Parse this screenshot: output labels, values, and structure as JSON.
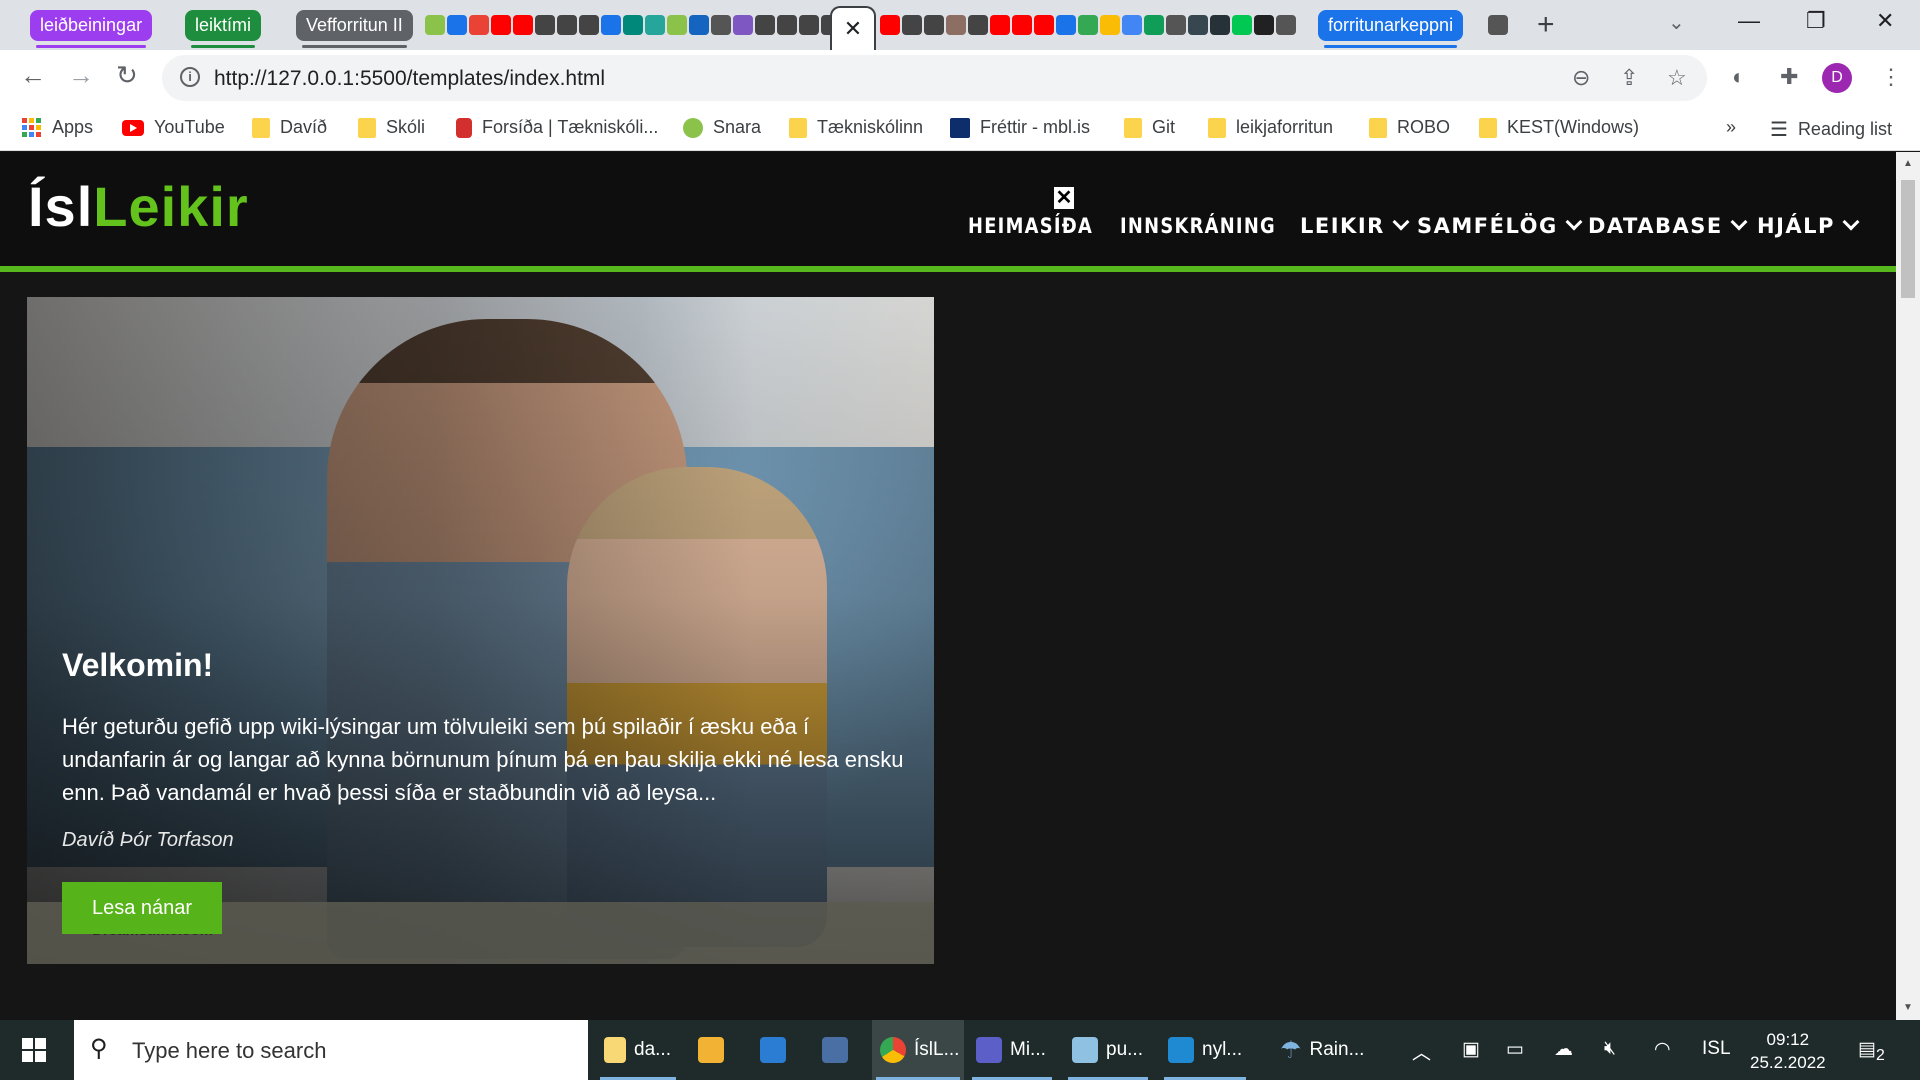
{
  "browser": {
    "tab_groups": [
      {
        "label": "leiðbeiningar",
        "color": "#9c3df0"
      },
      {
        "label": "leiktími",
        "color": "#1e8e3e"
      },
      {
        "label": "Vefforritun II",
        "color": "#5f6368"
      },
      {
        "label": "forritunarkeppni",
        "color": "#1a73e8"
      }
    ],
    "active_tab_close": "✕",
    "new_tab": "+",
    "url": "http://127.0.0.1:5500/templates/index.html",
    "profile_initial": "D"
  },
  "bookmarks": [
    {
      "label": "Apps",
      "icon": "apps-grid-icon"
    },
    {
      "label": "YouTube",
      "icon": "youtube-icon"
    },
    {
      "label": "Davíð",
      "icon": "folder-icon"
    },
    {
      "label": "Skóli",
      "icon": "folder-icon"
    },
    {
      "label": "Forsíða | Tækniskóli...",
      "icon": "tskoli-icon"
    },
    {
      "label": "Snara",
      "icon": "snara-icon"
    },
    {
      "label": "Tækniskólinn",
      "icon": "folder-icon"
    },
    {
      "label": "Fréttir - mbl.is",
      "icon": "mbl-icon"
    },
    {
      "label": "Git",
      "icon": "folder-icon"
    },
    {
      "label": "leikjaforritun",
      "icon": "folder-icon"
    },
    {
      "label": "ROBO",
      "icon": "folder-icon"
    },
    {
      "label": "KEST(Windows)",
      "icon": "folder-icon"
    }
  ],
  "bookmarks_more": "»",
  "reading_list": "Reading list",
  "site": {
    "logo_part1": "Ísl",
    "logo_part2": "Leikir",
    "nav": {
      "home": "HEIMASÍÐA",
      "login": "INNSKRÁNING",
      "games": "LEIKIR",
      "communities": "SAMFÉLÖG",
      "database": "DATABASE",
      "help": "HJÁLP"
    },
    "close_mark": "✕",
    "hero": {
      "title": "Velkomin!",
      "description": "Hér geturðu gefið upp wiki-lýsingar um tölvuleiki sem þú spilaðir í æsku eða í undanfarin ár og langar að kynna börnunum þínum þá en þau skilja ekki né lesa ensku enn. Það vandamál er hvað þessi síða er staðbundin við að leysa...",
      "author": "Davíð Þór Torfason",
      "button": "Lesa nánar",
      "watermark": "Dreamstime.com"
    }
  },
  "taskbar": {
    "search_placeholder": "Type here to search",
    "apps": [
      {
        "label": "da...",
        "icon": "file-explorer-icon"
      },
      {
        "label": "",
        "icon": "store-icon"
      },
      {
        "label": "",
        "icon": "calendar-icon"
      },
      {
        "label": "",
        "icon": "calculator-icon"
      },
      {
        "label": "ÍslL...",
        "icon": "chrome-icon"
      },
      {
        "label": "Mi...",
        "icon": "teams-icon"
      },
      {
        "label": "pu...",
        "icon": "notepad-icon"
      },
      {
        "label": "nyl...",
        "icon": "vscode-icon"
      }
    ],
    "weather": "Rain...",
    "language": "ISL",
    "time": "09:12",
    "date": "25.2.2022",
    "notifications": "2"
  }
}
